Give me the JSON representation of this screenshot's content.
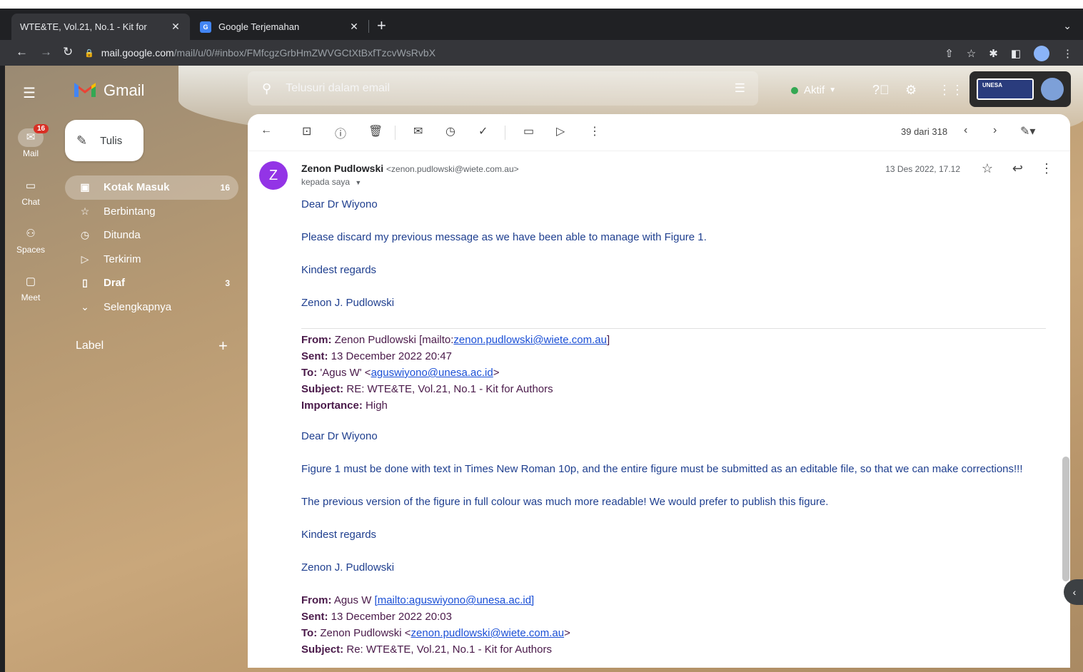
{
  "browser": {
    "tabs": [
      {
        "title": "WTE&TE, Vol.21, No.1 - Kit for",
        "close": "✕"
      },
      {
        "title": "Google Terjemahan",
        "close": "✕"
      }
    ],
    "new_tab": "+",
    "url_domain": "mail.google.com",
    "url_path": "/mail/u/0/#inbox/FMfcgzGrbHmZWVGCtXtBxfTzcvWsRvbX"
  },
  "gmail": {
    "product": "Gmail",
    "search_placeholder": "Telusuri dalam email",
    "status": "Aktif",
    "account_label": "UNESA"
  },
  "rail": {
    "mail": "Mail",
    "mail_badge": "16",
    "chat": "Chat",
    "spaces": "Spaces",
    "meet": "Meet"
  },
  "compose": "Tulis",
  "nav": [
    {
      "label": "Kotak Masuk",
      "count": "16"
    },
    {
      "label": "Berbintang",
      "count": ""
    },
    {
      "label": "Ditunda",
      "count": ""
    },
    {
      "label": "Terkirim",
      "count": ""
    },
    {
      "label": "Draf",
      "count": "3"
    },
    {
      "label": "Selengkapnya",
      "count": ""
    }
  ],
  "labels_header": "Label",
  "toolbar": {
    "pager": "39 dari 318"
  },
  "message": {
    "avatar_letter": "Z",
    "sender_name": "Zenon Pudlowski",
    "sender_email": "<zenon.pudlowski@wiete.com.au>",
    "to": "kepada saya",
    "date": "13 Des 2022, 17.12",
    "lines": {
      "greet1": "Dear Dr Wiyono",
      "p1": "Please discard my previous message as we have been able to manage with Figure 1.",
      "regards1": "Kindest regards",
      "sig1": "Zenon J. Pudlowski",
      "from1_label": "From:",
      "from1_text": " Zenon Pudlowski [mailto:",
      "from1_link": "zenon.pudlowski@wiete.com.au",
      "from1_end": "]",
      "sent1_label": "Sent:",
      "sent1_text": " 13 December 2022 20:47",
      "to1_label": "To:",
      "to1_text": " 'Agus W' <",
      "to1_link": "aguswiyono@unesa.ac.id",
      "to1_end": ">",
      "subj1_label": "Subject:",
      "subj1_text": " RE: WTE&TE, Vol.21, No.1 - Kit for Authors",
      "imp1_label": "Importance:",
      "imp1_text": " High",
      "greet2": "Dear Dr Wiyono",
      "p2": "Figure 1 must be done with text in Times New Roman 10p, and the entire figure must be submitted as an editable file, so that we can make corrections!!!",
      "p3": "The previous version of the figure in full colour was much more readable! We would prefer to publish this figure.",
      "regards2": "Kindest regards",
      "sig2": "Zenon J. Pudlowski",
      "from2_label": "From:",
      "from2_text": " Agus W ",
      "from2_link": "[mailto:aguswiyono@unesa.ac.id]",
      "sent2_label": "Sent:",
      "sent2_text": " 13 December 2022 20:03",
      "to2_label": "To:",
      "to2_text": " Zenon Pudlowski <",
      "to2_link": "zenon.pudlowski@wiete.com.au",
      "to2_end": ">",
      "subj2_label": "Subject:",
      "subj2_text": " Re: WTE&TE, Vol.21, No.1 - Kit for Authors"
    }
  }
}
